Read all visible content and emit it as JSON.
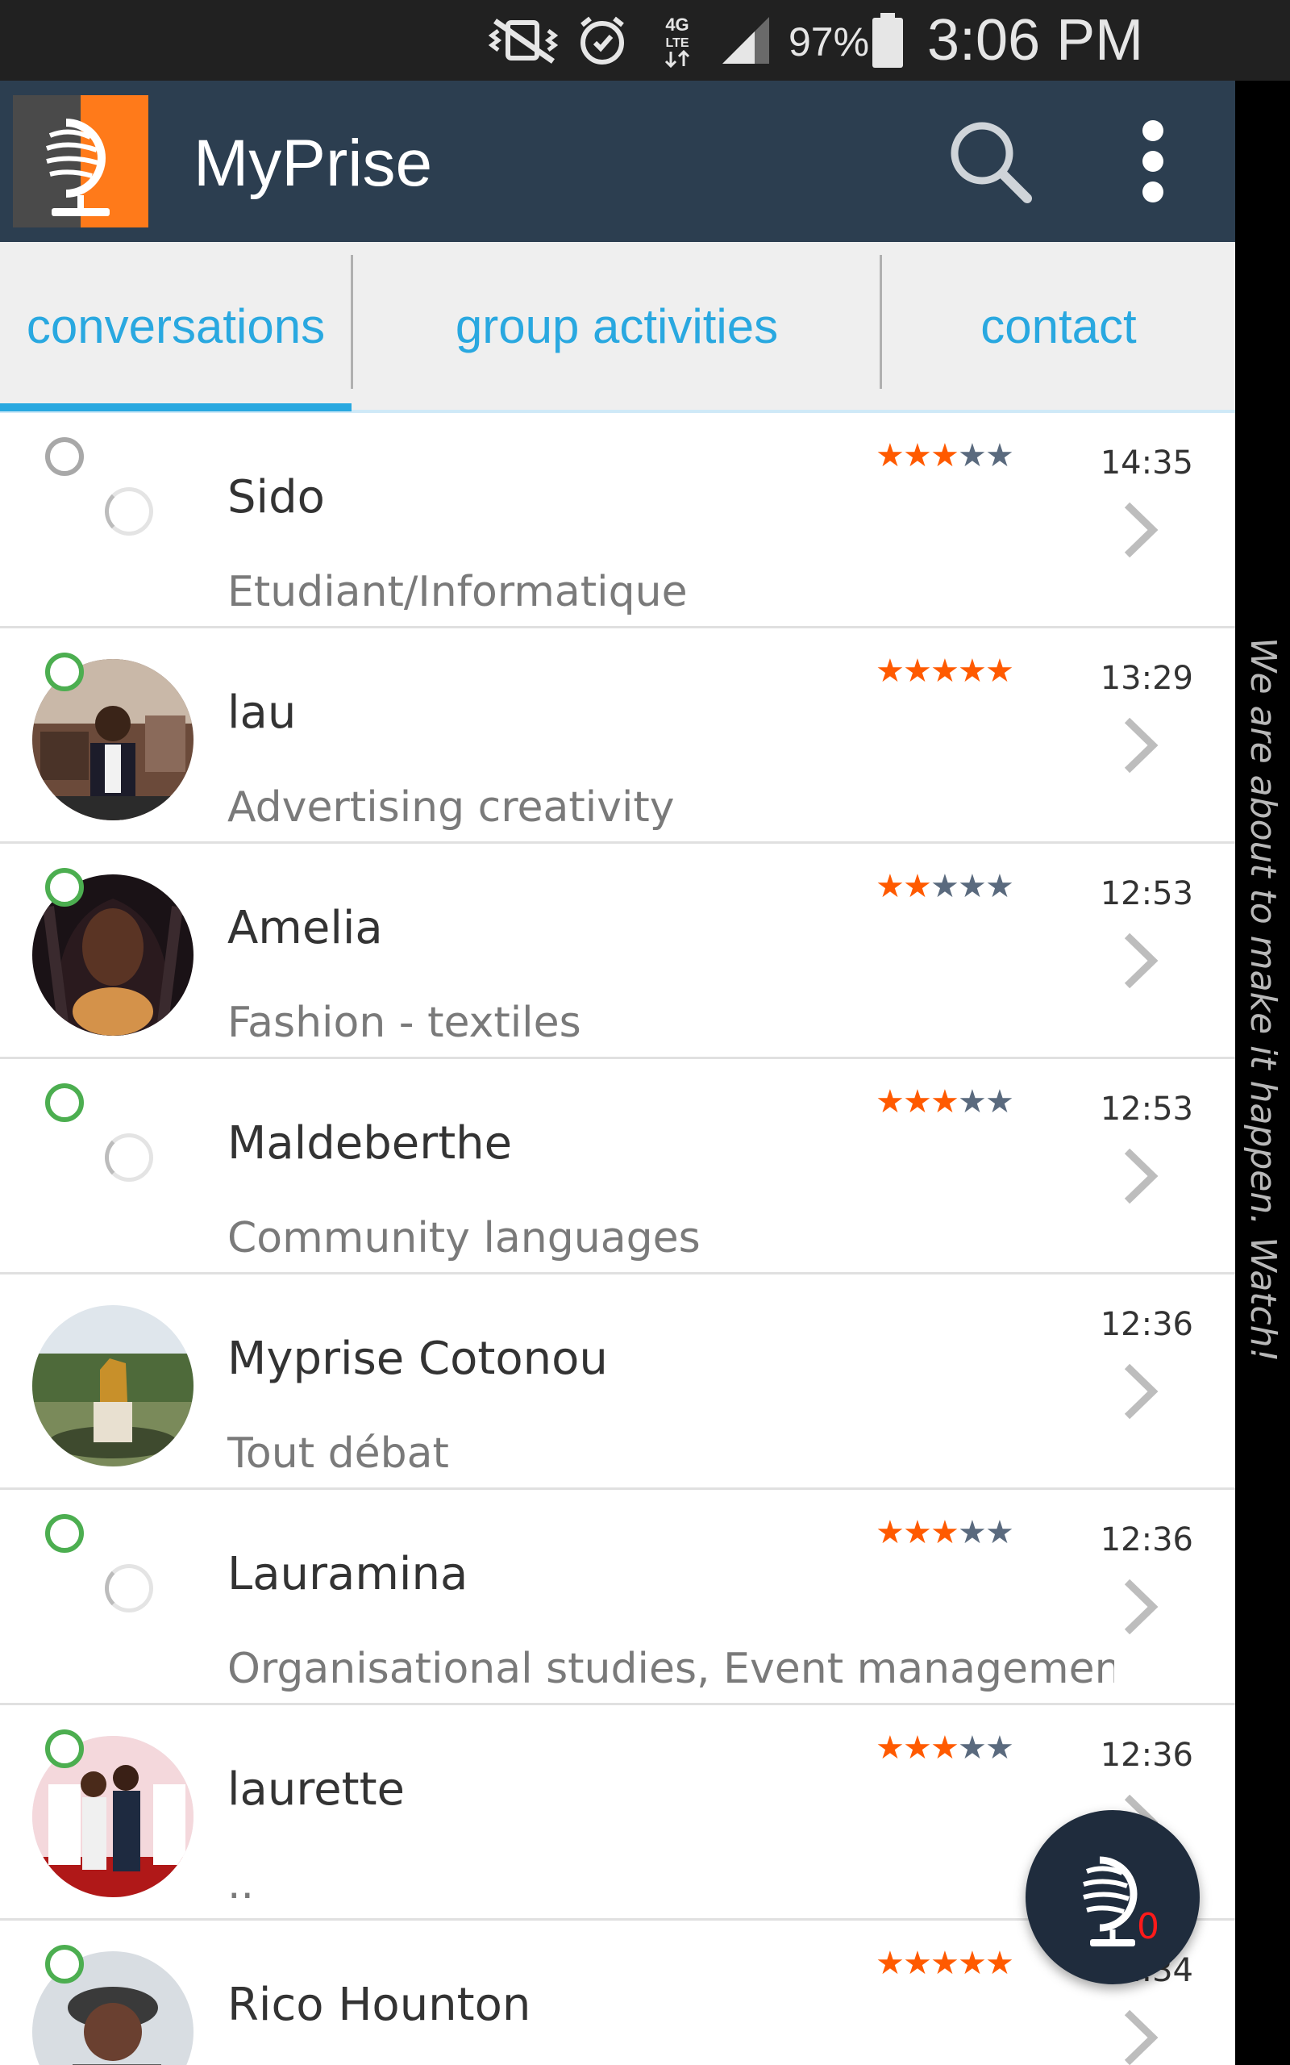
{
  "status_bar": {
    "battery_percent": "97%",
    "time": "3:06 PM",
    "network_label": "4G LTE",
    "icons": [
      "vibrate-mute-icon",
      "alarm-icon",
      "4g-lte-icon",
      "signal-icon",
      "battery-icon"
    ]
  },
  "app_bar": {
    "title": "MyPrise",
    "logo_icon": "myprise-logo-icon",
    "actions": [
      "search-icon",
      "overflow-menu-icon"
    ]
  },
  "tabs": [
    {
      "label": "conversations",
      "selected": true
    },
    {
      "label": "group activities",
      "selected": false
    },
    {
      "label": "contact",
      "selected": false
    }
  ],
  "side_banner": {
    "text": "We are about to make it happen. Watch!"
  },
  "conversations": [
    {
      "name": "Sido",
      "subtitle": "Etudiant/Informatique",
      "time": "14:35",
      "rating": 3,
      "online": false,
      "has_avatar": false
    },
    {
      "name": "lau",
      "subtitle": "Advertising creativity",
      "time": "13:29",
      "rating": 5,
      "online": true,
      "has_avatar": true
    },
    {
      "name": "Amelia",
      "subtitle": "Fashion - textiles",
      "time": "12:53",
      "rating": 2,
      "online": true,
      "has_avatar": true
    },
    {
      "name": "Maldeberthe",
      "subtitle": "Community languages",
      "time": "12:53",
      "rating": 3,
      "online": true,
      "has_avatar": false
    },
    {
      "name": "Myprise Cotonou",
      "subtitle": "Tout débat",
      "time": "12:36",
      "rating": null,
      "online": false,
      "has_avatar": true
    },
    {
      "name": "Lauramina",
      "subtitle": "Organisational studies, Event managemen...",
      "time": "12:36",
      "rating": 3,
      "online": true,
      "has_avatar": false
    },
    {
      "name": "laurette",
      "subtitle": "..",
      "time": "12:36",
      "rating": 3,
      "online": true,
      "has_avatar": true
    },
    {
      "name": "Rico Hounton",
      "subtitle": "",
      "time": "12:34",
      "rating": 5,
      "online": true,
      "has_avatar": true
    }
  ],
  "fab": {
    "icon": "myprise-logo-icon",
    "badge_count": "0"
  },
  "colors": {
    "status_bar": "#212121",
    "app_bar": "#2c3e50",
    "tab_text": "#29a8e0",
    "star_on": "#ff5a00",
    "star_off": "#5a6a7e",
    "online": "#4cae50",
    "fab": "#1f2c3d",
    "badge": "#ff1a1a"
  }
}
